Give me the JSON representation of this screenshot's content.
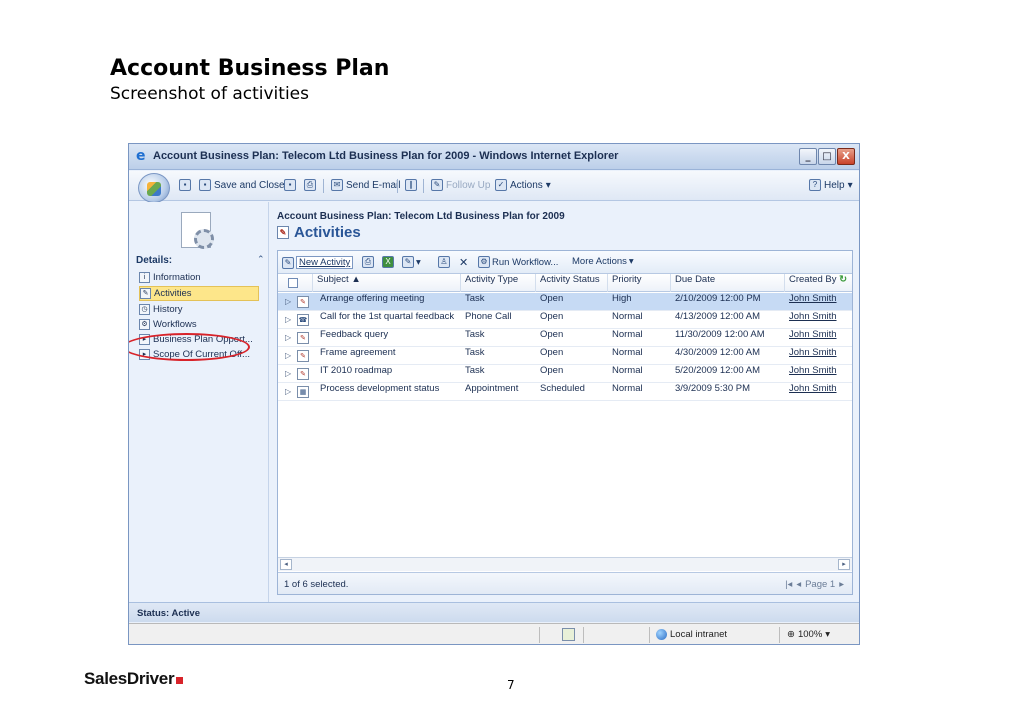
{
  "slide": {
    "title": "Account Business Plan",
    "subtitle": "Screenshot of activities",
    "page_number": "7",
    "logo_text": "SalesDriver",
    "logo_accent_color": "#d8232a"
  },
  "window": {
    "title": "Account Business Plan: Telecom Ltd Business Plan for 2009 - Windows Internet Explorer",
    "controls": {
      "minimize": "_",
      "maximize": "□",
      "close": "X"
    }
  },
  "toolbar": {
    "save_and_close": "Save and Close",
    "send_email": "Send E-mail",
    "follow_up": "Follow Up",
    "actions": "Actions",
    "help": "Help"
  },
  "left_nav": {
    "details_heading": "Details:",
    "items": [
      {
        "label": "Information",
        "icon": "information-icon"
      },
      {
        "label": "Activities",
        "icon": "activities-icon",
        "selected": true
      },
      {
        "label": "History",
        "icon": "history-icon"
      },
      {
        "label": "Workflows",
        "icon": "workflows-icon"
      },
      {
        "label": "Business Plan Opport...",
        "icon": "opportunity-icon"
      },
      {
        "label": "Scope Of Current Off...",
        "icon": "scope-icon"
      }
    ]
  },
  "main": {
    "record_title": "Account Business Plan: Telecom Ltd Business Plan for 2009",
    "section_title": "Activities"
  },
  "grid": {
    "toolbar": {
      "new_activity": "New Activity",
      "run_workflow": "Run Workflow...",
      "more_actions": "More Actions"
    },
    "columns": [
      "Subject",
      "Activity Type",
      "Activity Status",
      "Priority",
      "Due Date",
      "Created By"
    ],
    "rows": [
      {
        "subject": "Arrange offering meeting",
        "type": "Task",
        "status": "Open",
        "priority": "High",
        "due": "2/10/2009 12:00 PM",
        "created_by": "John Smith",
        "icon": "task-icon",
        "selected": true
      },
      {
        "subject": "Call for the 1st quartal feedback",
        "type": "Phone Call",
        "status": "Open",
        "priority": "Normal",
        "due": "4/13/2009 12:00 AM",
        "created_by": "John Smith",
        "icon": "phone-call-icon"
      },
      {
        "subject": "Feedback query",
        "type": "Task",
        "status": "Open",
        "priority": "Normal",
        "due": "11/30/2009 12:00 AM",
        "created_by": "John Smith",
        "icon": "task-icon"
      },
      {
        "subject": "Frame agreement",
        "type": "Task",
        "status": "Open",
        "priority": "Normal",
        "due": "4/30/2009 12:00 AM",
        "created_by": "John Smith",
        "icon": "task-icon"
      },
      {
        "subject": "IT 2010 roadmap",
        "type": "Task",
        "status": "Open",
        "priority": "Normal",
        "due": "5/20/2009 12:00 AM",
        "created_by": "John Smith",
        "icon": "task-icon"
      },
      {
        "subject": "Process development status",
        "type": "Appointment",
        "status": "Scheduled",
        "priority": "Normal",
        "due": "3/9/2009 5:30 PM",
        "created_by": "John Smith",
        "icon": "appointment-icon"
      }
    ],
    "selection_text": "1 of 6 selected.",
    "pager_text": "Page 1"
  },
  "status": {
    "record_status": "Status: Active",
    "zone": "Local intranet",
    "zoom": "100%"
  }
}
